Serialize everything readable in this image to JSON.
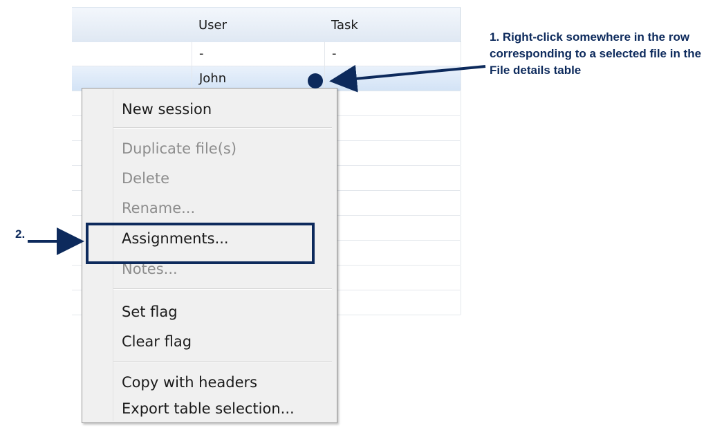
{
  "table": {
    "columns": [
      "",
      "User",
      "Task"
    ],
    "rows": [
      [
        "",
        "-",
        "-"
      ],
      [
        "",
        "John",
        ""
      ],
      [
        "",
        "",
        "-"
      ],
      [
        "",
        "",
        "-"
      ],
      [
        "",
        "",
        "-"
      ],
      [
        "",
        "",
        "-"
      ],
      [
        "",
        "",
        "-"
      ],
      [
        "",
        "",
        "-"
      ],
      [
        "",
        "",
        "-"
      ],
      [
        "",
        "",
        "-"
      ],
      [
        "",
        "",
        "-"
      ]
    ],
    "selected_row": 1
  },
  "context_menu": {
    "items": [
      {
        "label": "New session",
        "enabled": true
      },
      {
        "label": "Duplicate file(s)",
        "enabled": false
      },
      {
        "label": "Delete",
        "enabled": false
      },
      {
        "label": "Rename...",
        "enabled": false
      },
      {
        "label": "Assignments...",
        "enabled": true
      },
      {
        "label": "Notes...",
        "enabled": false
      },
      {
        "label": "Set flag",
        "enabled": true
      },
      {
        "label": "Clear flag",
        "enabled": true
      },
      {
        "label": "Copy with headers",
        "enabled": true
      },
      {
        "label": "Export table selection...",
        "enabled": true
      }
    ]
  },
  "annotations": {
    "callout_1": "1. Right-click somewhere in the row corresponding to a selected file in the File details table",
    "callout_2": "2."
  },
  "colors": {
    "annotation": "#0d2a5c",
    "menu_background": "#f0f0f0",
    "selected_row": "#d3e3f6",
    "disabled_text": "#8d8d8d"
  }
}
